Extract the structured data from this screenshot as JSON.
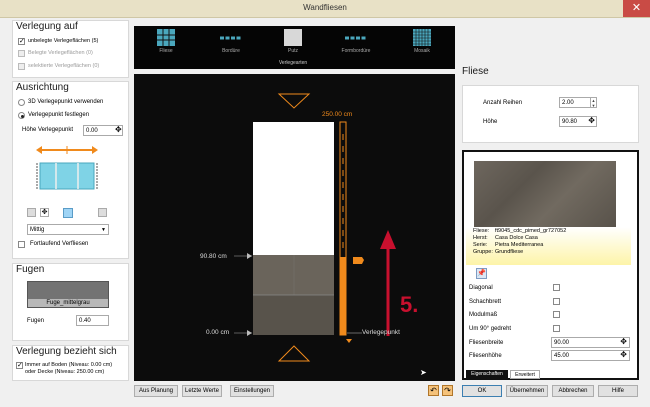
{
  "window": {
    "title": "Wandfliesen",
    "close": "✕"
  },
  "verlegung_auf": {
    "title": "Verlegung auf",
    "items": [
      {
        "label": "unbelegte Verlegeflächen (5)",
        "checked": true
      },
      {
        "label": "Belegte Verlegeflächen (0)",
        "checked": false
      },
      {
        "label": "selektierte Verlegeflächen (0)",
        "checked": false
      }
    ]
  },
  "ausrichtung": {
    "title": "Ausrichtung",
    "radio1": "3D Verlegepunkt verwenden",
    "radio2": "Verlegepunkt festlegen",
    "hoehe_label": "Höhe Verlegepunkt",
    "hoehe_value": "0.00",
    "mittig": "Mittig",
    "fortlaufend": "Fortlaufend Verfliesen"
  },
  "fugen": {
    "title": "Fugen",
    "swatch_label": "Fuge_mittelgrau",
    "label": "Fugen",
    "value": "0.40"
  },
  "bezieht": {
    "title": "Verlegung bezieht sich",
    "text1": "Immer auf Boden (Niveau: 0.00 cm)",
    "text2": "oder Decke (Niveau: 250.00 cm)"
  },
  "toolbar": {
    "items": [
      {
        "label": "Fliese",
        "icon": "grid-icon"
      },
      {
        "label": "Bordüre",
        "icon": "border-icon"
      },
      {
        "label": "Putz",
        "icon": "plaster-icon"
      },
      {
        "label": "Formbordüre",
        "icon": "shape-border-icon"
      },
      {
        "label": "Mosaik",
        "icon": "mosaic-icon"
      }
    ],
    "caption": "Verlegearten"
  },
  "canvas": {
    "label_top": "250.00 cm",
    "label_mid": "90.80 cm",
    "label_bottom": "0.00 cm",
    "verlegepunkt": "Verlegepunkt",
    "annotation": "5."
  },
  "bottom_left_buttons": [
    "Aus Planung",
    "Letzte Werte",
    "Einstellungen"
  ],
  "fliese": {
    "title": "Fliese",
    "rows_label": "Anzahl Reihen",
    "rows_value": "2.00",
    "height_label": "Höhe",
    "height_value": "90.80"
  },
  "tile_info": {
    "rows": [
      {
        "k": "Fliese:",
        "v": "ft9045_cdc_pimed_gr727052"
      },
      {
        "k": "Herst:",
        "v": "Casa Dolce Casa"
      },
      {
        "k": "Serie:",
        "v": "Pietra Mediterranea"
      },
      {
        "k": "Gruppe:",
        "v": "Grundfliese"
      }
    ]
  },
  "properties": [
    {
      "label": "Diagonal",
      "type": "check"
    },
    {
      "label": "Schachbrett",
      "type": "check"
    },
    {
      "label": "Modulmaß",
      "type": "check"
    },
    {
      "label": "Um 90° gedreht",
      "type": "check"
    },
    {
      "label": "Fliesenbreite",
      "type": "field",
      "value": "90.00"
    },
    {
      "label": "Fliesenhöhe",
      "type": "field",
      "value": "45.00"
    }
  ],
  "tabs": [
    "Eigenschaften",
    "Erweitert"
  ],
  "dialog_buttons": [
    "OK",
    "Übernehmen",
    "Abbrechen",
    "Hilfe"
  ],
  "colors": {
    "accent": "#f08a1c",
    "red_arrow": "#c8102e",
    "titlebar": "#e8e1c6",
    "canvas": "#0c0c0c"
  }
}
